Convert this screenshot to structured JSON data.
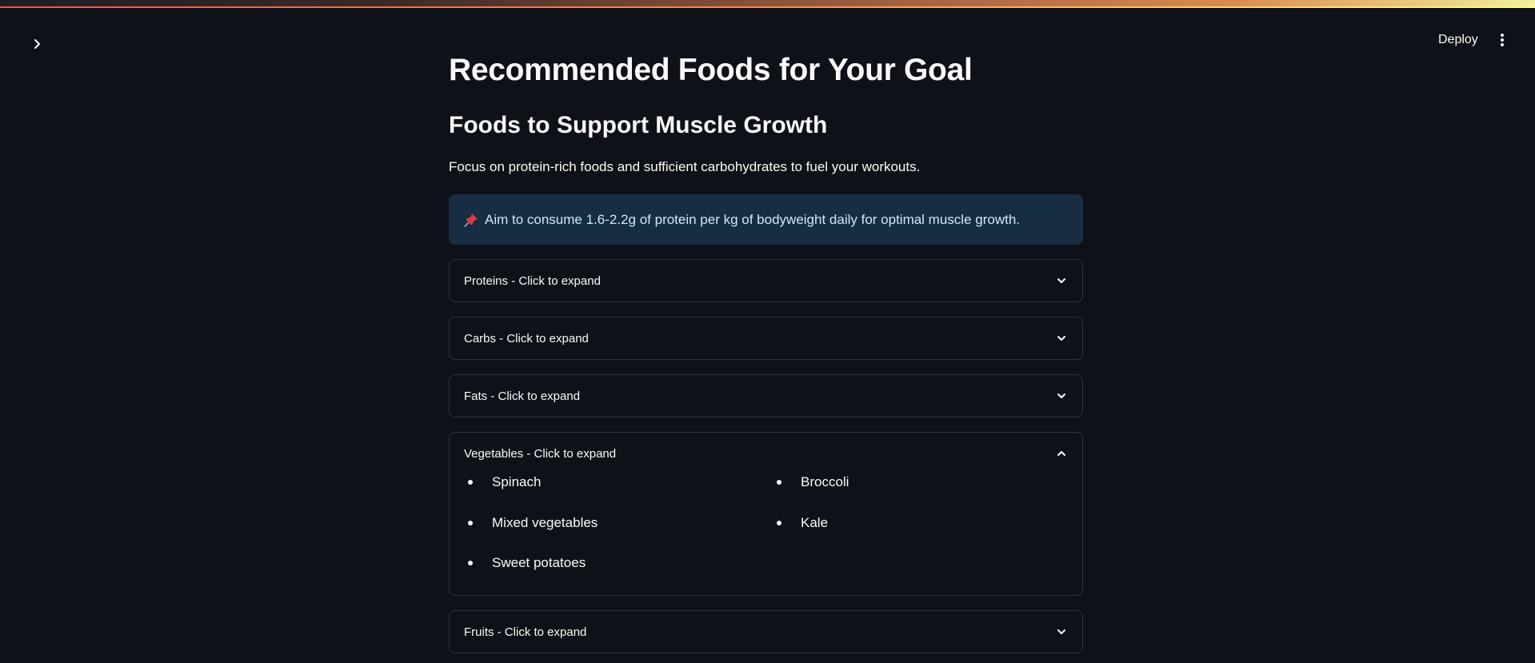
{
  "header": {
    "deploy_label": "Deploy"
  },
  "main": {
    "page_title": "Recommended Foods for Your Goal",
    "section_title": "Foods to Support Muscle Growth",
    "intro": "Focus on protein-rich foods and sufficient carbohydrates to fuel your workouts.",
    "info": {
      "icon": "pushpin-icon",
      "text": "Aim to consume 1.6-2.2g of protein per kg of bodyweight daily for optimal muscle growth."
    },
    "expanders": [
      {
        "label": "Proteins - Click to expand",
        "expanded": false
      },
      {
        "label": "Carbs - Click to expand",
        "expanded": false
      },
      {
        "label": "Fats - Click to expand",
        "expanded": false
      },
      {
        "label": "Vegetables - Click to expand",
        "expanded": true,
        "items": [
          "Spinach",
          "Broccoli",
          "Mixed vegetables",
          "Kale",
          "Sweet potatoes"
        ]
      },
      {
        "label": "Fruits - Click to expand",
        "expanded": false
      }
    ]
  },
  "colors": {
    "background": "#0e1117",
    "info_background": "#172d43",
    "info_text": "#c7ebff",
    "border": "#31333f"
  }
}
